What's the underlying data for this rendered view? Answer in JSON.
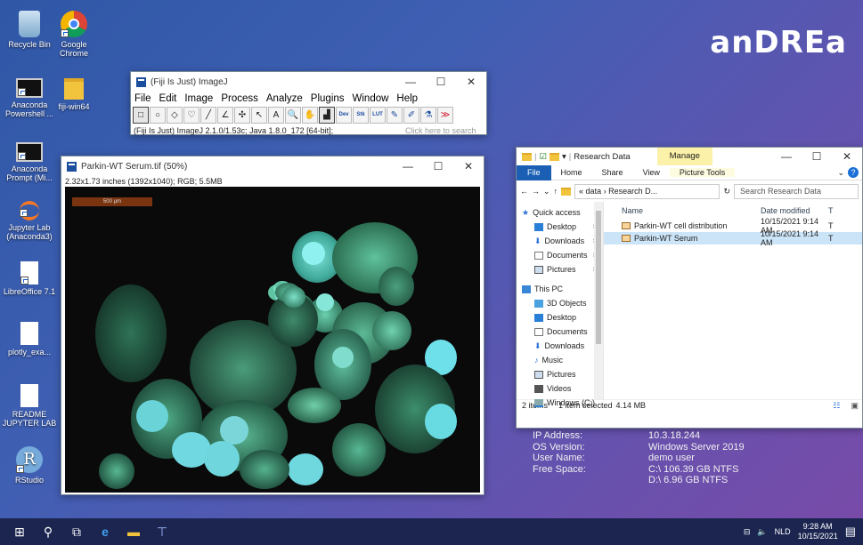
{
  "desktop": {
    "icons": [
      {
        "label": "Recycle Bin"
      },
      {
        "label": "Google Chrome"
      },
      {
        "label": "Anaconda Powershell ..."
      },
      {
        "label": "fiji-win64"
      },
      {
        "label": "Anaconda Prompt (Mi..."
      },
      {
        "label": "Jupyter Lab (Anaconda3)"
      },
      {
        "label": "LibreOffice 7.1"
      },
      {
        "label": "plotly_exa..."
      },
      {
        "label": "README JUPYTER LAB"
      },
      {
        "label": "RStudio"
      }
    ],
    "logo": "anDREa"
  },
  "imagej": {
    "title": "(Fiji Is Just) ImageJ",
    "menu": [
      "File",
      "Edit",
      "Image",
      "Process",
      "Analyze",
      "Plugins",
      "Window",
      "Help"
    ],
    "tools": [
      "□",
      "○",
      "◇",
      "♡",
      "╱",
      "∠",
      "✣",
      "↖",
      "A",
      "🔍",
      "✋",
      "▟",
      "Dev",
      "Stk",
      "LUT",
      "✎",
      "✐",
      "⚗",
      "≫"
    ],
    "status": "(Fiji Is Just) ImageJ 2.1.0/1.53c; Java 1.8.0_172 [64-bit];",
    "search_placeholder": "Click here to search"
  },
  "image_window": {
    "title": "Parkin-WT Serum.tif (50%)",
    "info": "2.32x1.73 inches (1392x1040); RGB; 5.5MB",
    "scalebar": "500 μm"
  },
  "explorer": {
    "title": "Research Data",
    "manage_tab": "Manage",
    "ribbon": [
      "File",
      "Home",
      "Share",
      "View",
      "Picture Tools"
    ],
    "address": "« data › Research D...",
    "search_placeholder": "Search Research Data",
    "nav": {
      "quick_access": "Quick access",
      "quick_items": [
        "Desktop",
        "Downloads",
        "Documents",
        "Pictures"
      ],
      "this_pc": "This PC",
      "pc_items": [
        "3D Objects",
        "Desktop",
        "Documents",
        "Downloads",
        "Music",
        "Pictures",
        "Videos",
        "Windows (C:)"
      ]
    },
    "columns": {
      "name": "Name",
      "date": "Date modified",
      "type": "T"
    },
    "files": [
      {
        "name": "Parkin-WT cell distribution",
        "date": "10/15/2021 9:14 AM",
        "type": "T"
      },
      {
        "name": "Parkin-WT Serum",
        "date": "10/15/2021 9:14 AM",
        "type": "T"
      }
    ],
    "status": {
      "items": "2 items",
      "selected": "1 item selected",
      "size": "4.14 MB"
    }
  },
  "bginfo": [
    {
      "k": "IP Address:",
      "v": "10.3.18.244"
    },
    {
      "k": "OS Version:",
      "v": "Windows Server 2019"
    },
    {
      "k": "User Name:",
      "v": "demo user"
    },
    {
      "k": "Free Space:",
      "v": "C:\\ 106.39 GB NTFS"
    },
    {
      "k": "",
      "v": "D:\\ 6.96 GB NTFS"
    }
  ],
  "taskbar": {
    "lang": "NLD",
    "time": "9:28 AM",
    "date": "10/15/2021"
  }
}
